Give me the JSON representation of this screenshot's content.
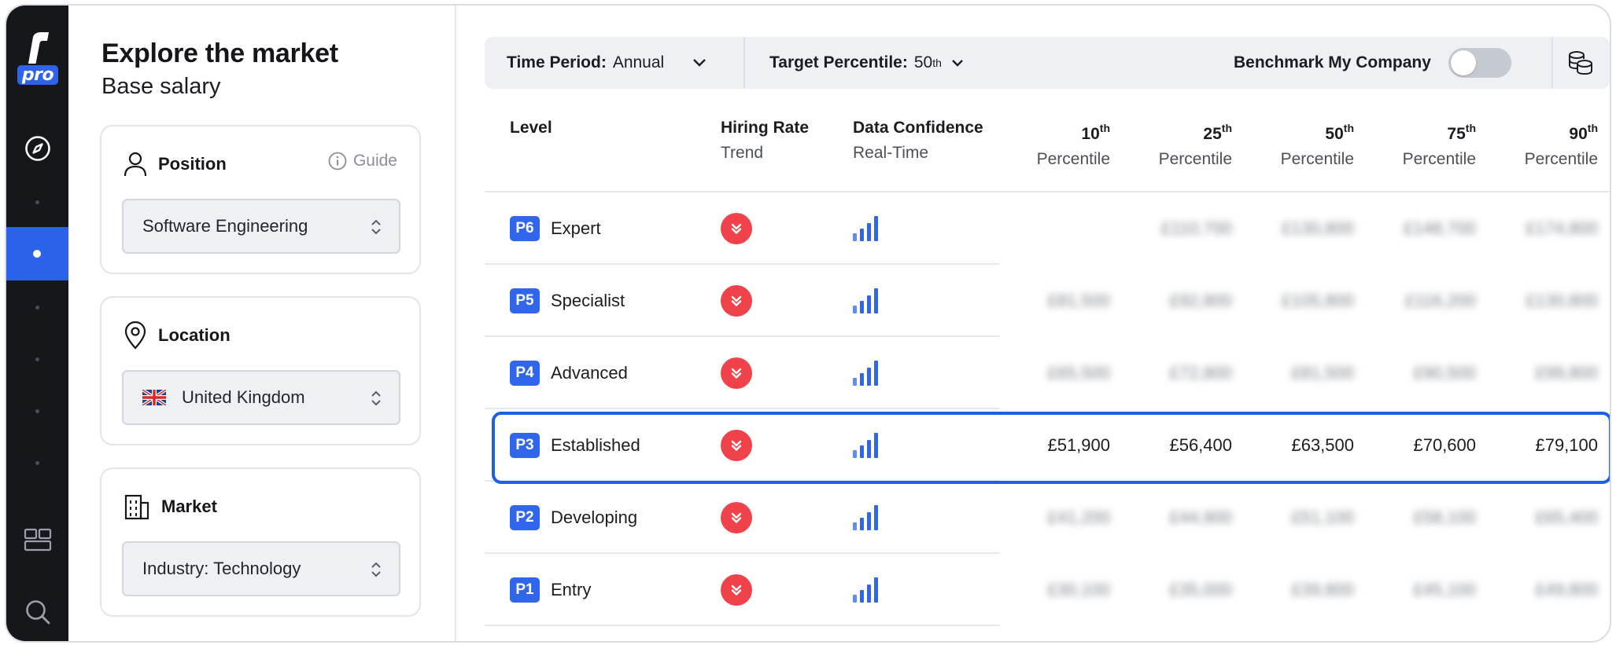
{
  "brand": {
    "logo_letter": "r",
    "logo_badge": "pro",
    "accent": "#2f66ea"
  },
  "rail": {
    "icons": [
      "compass-icon",
      "dot",
      "active-dot",
      "dot",
      "dot",
      "dot",
      "dot",
      "layout-icon",
      "search-icon"
    ]
  },
  "panel": {
    "title": "Explore the market",
    "subtitle": "Base salary",
    "position": {
      "label": "Position",
      "guide": "Guide",
      "value": "Software Engineering"
    },
    "location": {
      "label": "Location",
      "value": "United Kingdom"
    },
    "market": {
      "label": "Market",
      "value": "Industry: Technology"
    }
  },
  "toolbar": {
    "time_period_label": "Time Period:",
    "time_period_value": "Annual",
    "target_label": "Target Percentile:",
    "target_value": "50",
    "target_sup": "th",
    "benchmark_label": "Benchmark My Company",
    "benchmark_on": false
  },
  "table": {
    "headers": {
      "level": "Level",
      "hiring_rate": "Hiring Rate",
      "hiring_rate_sub": "Trend",
      "confidence": "Data Confidence",
      "confidence_sub": "Real-Time",
      "percentile_sub": "Percentile",
      "percentiles": [
        {
          "num": "10",
          "sup": "th"
        },
        {
          "num": "25",
          "sup": "th"
        },
        {
          "num": "50",
          "sup": "th"
        },
        {
          "num": "75",
          "sup": "th"
        },
        {
          "num": "90",
          "sup": "th"
        }
      ]
    },
    "rows": [
      {
        "code": "P6",
        "name": "Expert",
        "values": [
          "",
          "£110,700",
          "£130,800",
          "£148,700",
          "£174,800"
        ],
        "blurred": true
      },
      {
        "code": "P5",
        "name": "Specialist",
        "values": [
          "£81,500",
          "£92,800",
          "£105,800",
          "£116,200",
          "£130,800"
        ],
        "blurred": true
      },
      {
        "code": "P4",
        "name": "Advanced",
        "values": [
          "£65,500",
          "£72,800",
          "£81,500",
          "£90,500",
          "£99,800"
        ],
        "blurred": true
      },
      {
        "code": "P3",
        "name": "Established",
        "values": [
          "£51,900",
          "£56,400",
          "£63,500",
          "£70,600",
          "£79,100"
        ],
        "blurred": false
      },
      {
        "code": "P2",
        "name": "Developing",
        "values": [
          "£41,200",
          "£44,900",
          "£51,100",
          "£58,100",
          "£65,400"
        ],
        "blurred": true
      },
      {
        "code": "P1",
        "name": "Entry",
        "values": [
          "£30,100",
          "£35,000",
          "£39,800",
          "£45,100",
          "£49,800"
        ],
        "blurred": true
      }
    ]
  }
}
